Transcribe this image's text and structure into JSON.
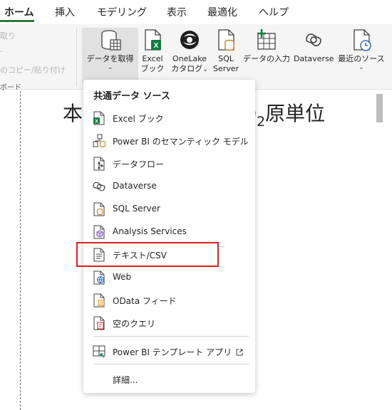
{
  "tabs": [
    {
      "label": "ホーム",
      "active": true
    },
    {
      "label": "挿入"
    },
    {
      "label": "モデリング"
    },
    {
      "label": "表示"
    },
    {
      "label": "最適化"
    },
    {
      "label": "ヘルプ"
    }
  ],
  "ribbon": {
    "clipboard": {
      "items": [
        "取り",
        "-",
        "のコピー/貼り付け"
      ],
      "group_label": "ボード"
    },
    "get_data": {
      "label": "データを取得",
      "chevron": "⌄"
    },
    "excel": {
      "line1": "Excel",
      "line2": "ブック"
    },
    "onelake": {
      "line1": "OneLake",
      "line2": "カタログ",
      "chevron": "⌄"
    },
    "sql": {
      "line1": "SQL",
      "line2": "Server"
    },
    "enter_data": {
      "label": "データの入力"
    },
    "dataverse": {
      "label": "Dataverse"
    },
    "recent": {
      "label": "最近のソース",
      "chevron": "⌄"
    }
  },
  "background": {
    "title_left": "本",
    "title_right_pre": "O",
    "title_right_sub": "2",
    "title_right_post": "原単位"
  },
  "dropdown": {
    "header": "共通データ ソース",
    "items": [
      {
        "label": "Excel ブック",
        "icon": "excel-icon"
      },
      {
        "label": "Power BI のセマンティック モデル",
        "icon": "semantic-model-icon"
      },
      {
        "label": "データフロー",
        "icon": "dataflow-icon"
      },
      {
        "label": "Dataverse",
        "icon": "dataverse-icon"
      },
      {
        "label": "SQL Server",
        "icon": "sql-server-icon"
      },
      {
        "label": "Analysis Services",
        "icon": "analysis-services-icon"
      },
      {
        "label": "テキスト/CSV",
        "icon": "text-csv-icon",
        "highlighted": true
      },
      {
        "label": "Web",
        "icon": "web-icon"
      },
      {
        "label": "OData フィード",
        "icon": "odata-icon"
      },
      {
        "label": "空のクエリ",
        "icon": "blank-query-icon"
      }
    ],
    "template_item": {
      "label": "Power BI テンプレート アプリ",
      "icon": "template-app-icon",
      "external": "external-link-icon"
    },
    "more": {
      "label": "詳細..."
    }
  },
  "colors": {
    "accent_green": "#2b7a3a",
    "highlight_red": "#e01e1e",
    "excel_green": "#107c41",
    "icon_orange": "#c8811a",
    "icon_purple": "#8a5cc8",
    "icon_blue": "#2f6fbd"
  }
}
